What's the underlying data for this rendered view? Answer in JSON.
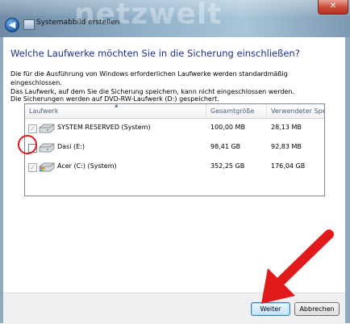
{
  "window": {
    "title": "Systemabbild erstellen",
    "watermark": "netzwelt",
    "close_label": "✕",
    "back_icon": "back-arrow-icon"
  },
  "page": {
    "heading": "Welche Laufwerke möchten Sie in die Sicherung einschließen?",
    "description_line1": "Die für die Ausführung von Windows erforderlichen Laufwerke werden standardmäßig eingeschlossen.",
    "description_line2": "Das Laufwerk, auf dem Sie die Sicherung speichern, kann nicht eingeschlossen werden.",
    "backup_info": "Die Sicherungen werden auf DVD-RW-Laufwerk (D:) gespeichert."
  },
  "drives_table": {
    "columns": [
      "Laufwerk",
      "Gesamtgröße",
      "Verwendeter Spe..."
    ],
    "rows": [
      {
        "name": "SYSTEM RESERVED (System)",
        "total": "100,00 MB",
        "used": "28,13 MB",
        "checked": true,
        "enabled": false,
        "icon": "hard-drive-icon"
      },
      {
        "name": "Dasi (E:)",
        "total": "98,41 GB",
        "used": "92,83 MB",
        "checked": false,
        "enabled": true,
        "icon": "hard-drive-icon"
      },
      {
        "name": "Acer (C:) (System)",
        "total": "352,25 GB",
        "used": "176,04 GB",
        "checked": true,
        "enabled": false,
        "icon": "windows-drive-icon"
      }
    ]
  },
  "buttons": {
    "next": "Weiter",
    "cancel": "Abbrechen"
  },
  "colors": {
    "heading": "#1e3287",
    "annotation_red": "#e11b1b"
  }
}
